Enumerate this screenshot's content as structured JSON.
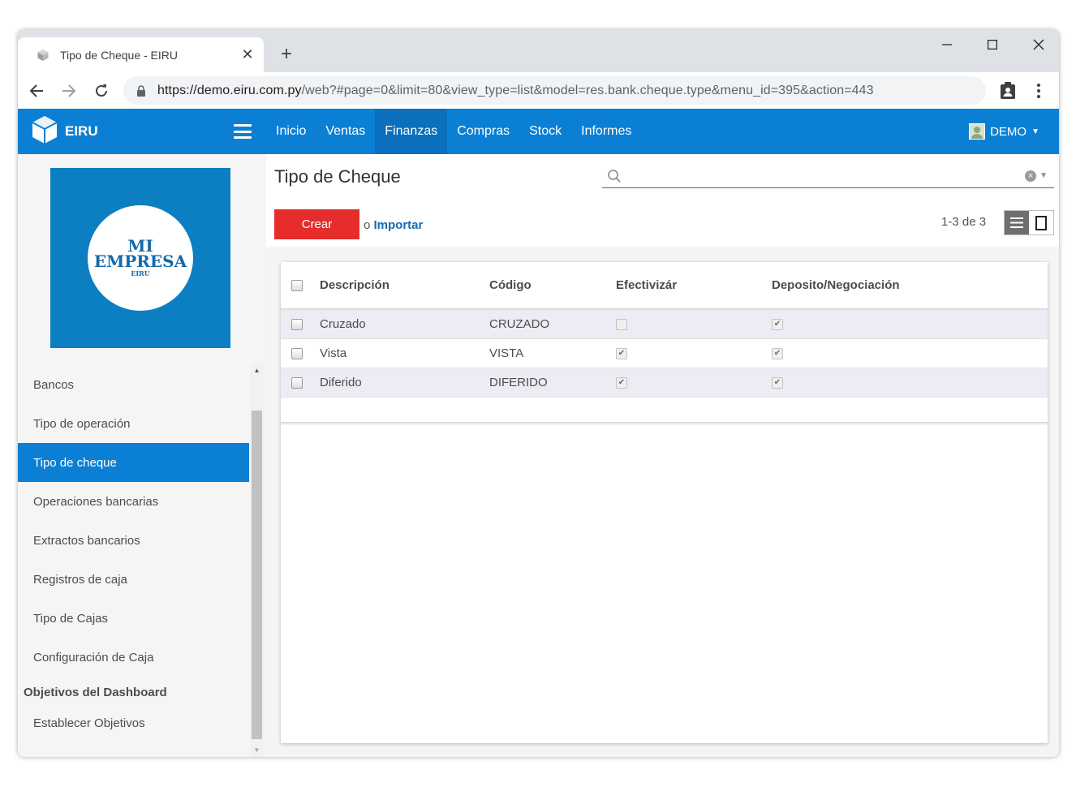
{
  "browser": {
    "tab_title": "Tipo de Cheque - EIRU",
    "url_host": "https://demo.eiru.com.py",
    "url_path": "/web?#page=0&limit=80&view_type=list&model=res.bank.cheque.type&menu_id=395&action=443",
    "icons": [
      "favicon-icon",
      "close-icon",
      "plus-icon",
      "minimize-icon",
      "maximize-icon",
      "window-close-icon",
      "back-icon",
      "forward-icon",
      "reload-icon",
      "lock-icon",
      "extension-icon",
      "more-menu-icon"
    ]
  },
  "appbar": {
    "brand": "EIRU",
    "menu": [
      "Inicio",
      "Ventas",
      "Finanzas",
      "Compras",
      "Stock",
      "Informes"
    ],
    "active_menu": "Finanzas",
    "user": "DEMO",
    "color": "#0b7fd4"
  },
  "sidebar": {
    "logo": {
      "line1": "MI",
      "line2": "EMPRESA",
      "line3": "EIRU",
      "bg": "#0b7fc1"
    },
    "items": [
      "Bancos",
      "Tipo de operación",
      "Tipo de cheque",
      "Operaciones bancarias",
      "Extractos bancarios",
      "Registros de caja",
      "Tipo de Cajas",
      "Configuración de Caja"
    ],
    "active_item": "Tipo de cheque",
    "section_heading": "Objetivos del Dashboard",
    "section_items": [
      "Establecer Objetivos"
    ]
  },
  "main": {
    "title": "Tipo de Cheque",
    "search": {
      "value": "",
      "placeholder": ""
    },
    "create_label": "Crear",
    "import_prefix": "o",
    "import_label": "Importar",
    "pager": "1-3 de 3",
    "columns": [
      "Descripción",
      "Código",
      "Efectivizár",
      "Deposito/Negociación"
    ],
    "rows": [
      {
        "descripcion": "Cruzado",
        "codigo": "CRUZADO",
        "efectivizar": false,
        "deposito": true
      },
      {
        "descripcion": "Vista",
        "codigo": "VISTA",
        "efectivizar": true,
        "deposito": true
      },
      {
        "descripcion": "Diferido",
        "codigo": "DIFERIDO",
        "efectivizar": true,
        "deposito": true
      }
    ],
    "create_color": "#e72c2c"
  }
}
